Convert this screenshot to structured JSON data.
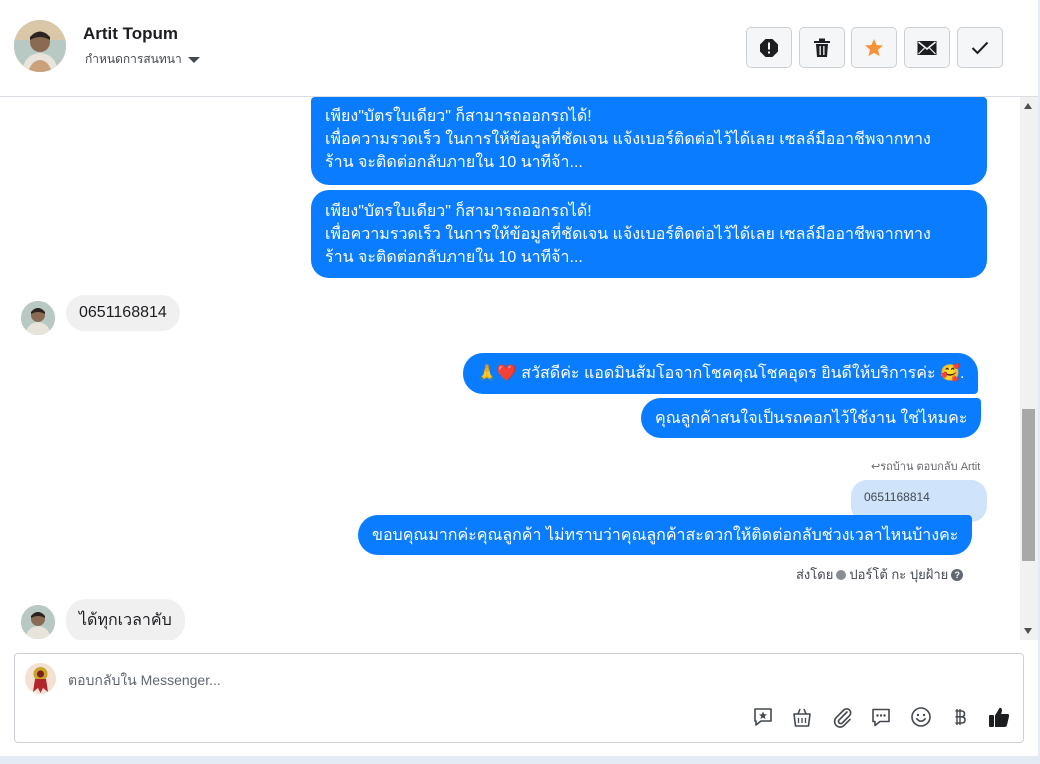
{
  "header": {
    "contact_name": "Artit Topum",
    "assign_label": "กำหนดการสนทนา",
    "actions": [
      "spam-icon",
      "trash-icon",
      "star-icon",
      "mail-icon",
      "check-icon"
    ]
  },
  "messages": {
    "promo_1": {
      "line1": "เพียง\"บัตรใบเดียว\" ก็สามารถออกรถได้!",
      "line2": "เพื่อความรวดเร็ว ในการให้ข้อมูลที่ชัดเจน แจ้งเบอร์ติดต่อไว้ได้เลย เซลล์มืออาชีพจากทาง",
      "line3": "ร้าน จะติดต่อกลับภายใน 10 นาทีจ้า..."
    },
    "promo_2": {
      "line1": "เพียง\"บัตรใบเดียว\" ก็สามารถออกรถได้!",
      "line2": "เพื่อความรวดเร็ว ในการให้ข้อมูลที่ชัดเจน แจ้งเบอร์ติดต่อไว้ได้เลย เซลล์มืออาชีพจากทาง",
      "line3": "ร้าน จะติดต่อกลับภายใน 10 นาทีจ้า..."
    },
    "customer_phone": "0651168814",
    "greeting": "🙏❤️ สวัสดีค่ะ แอดมินส้มโอจากโชคคุณโชคอุดร ยินดีให้บริการค่ะ 🥰.",
    "question": "คุณลูกค้าสนใจเป็นรถคอกไว้ใช้งาน ใช่ไหมคะ",
    "reply_note": "รถบ้าน ตอบกลับ Artit",
    "quoted": "0651168814",
    "thanks": "ขอบคุณมากค่ะคุณลูกค้า ไม่ทราบว่าคุณลูกค้าสะดวกให้ติดต่อกลับช่วงเวลาไหนบ้างคะ",
    "sent_by_label": "ส่งโดย",
    "sent_by_name": "ปอร์โต้ กะ ปุยฝ้าย",
    "customer_last": "ได้ทุกเวลาคับ"
  },
  "composer": {
    "placeholder": "ตอบกลับใน Messenger...",
    "tools": [
      "saved-reply-icon",
      "shop-bag-icon",
      "attachment-icon",
      "chat-bubble-icon",
      "emoji-icon",
      "baht-icon",
      "like-icon"
    ]
  },
  "colors": {
    "outgoing_bubble": "#0a7cff",
    "incoming_bubble": "#f0f0f0",
    "star": "#f7923b",
    "quote_bg": "#cfe3fb"
  }
}
